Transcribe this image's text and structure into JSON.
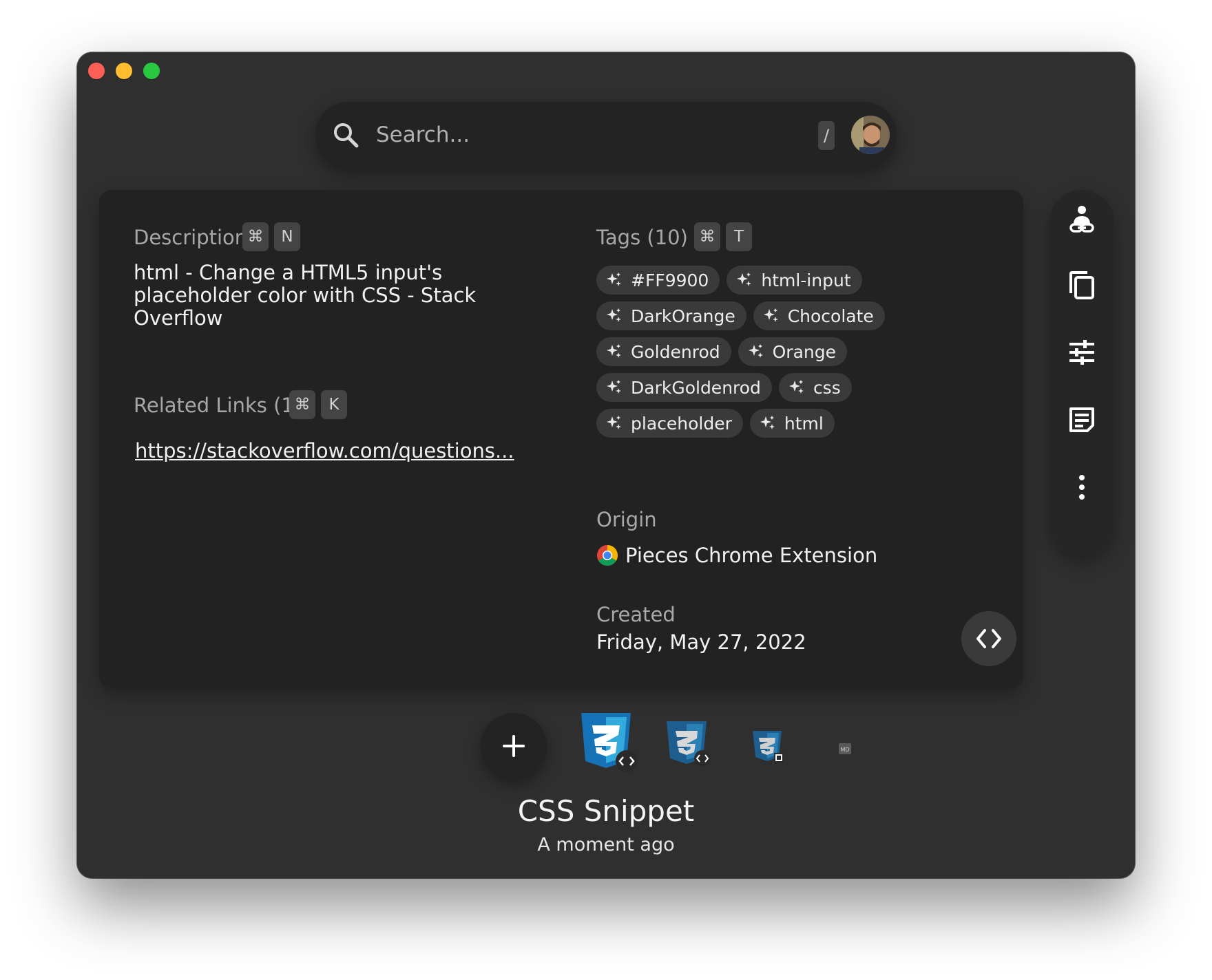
{
  "search": {
    "placeholder": "Search...",
    "shortcut": "/"
  },
  "description": {
    "label": "Description",
    "kbd": [
      "⌘",
      "N"
    ],
    "text": "html - Change a HTML5 input's placeholder color with CSS - Stack Overflow"
  },
  "related_links": {
    "label": "Related Links (1)",
    "kbd": [
      "⌘",
      "K"
    ],
    "links": [
      "https://stackoverflow.com/questions..."
    ]
  },
  "tags": {
    "label": "Tags (10)",
    "kbd": [
      "⌘",
      "T"
    ],
    "items": [
      "#FF9900",
      "html-input",
      "DarkOrange",
      "Chocolate",
      "Goldenrod",
      "Orange",
      "DarkGoldenrod",
      "css",
      "placeholder",
      "html"
    ]
  },
  "origin": {
    "label": "Origin",
    "value": "Pieces Chrome Extension",
    "icon": "chrome-icon"
  },
  "created": {
    "label": "Created",
    "value": "Friday, May 27, 2022"
  },
  "rail": {
    "icons": [
      "share-link-icon",
      "copy-icon",
      "tune-icon",
      "notes-icon",
      "more-vert-icon"
    ]
  },
  "snippet": {
    "title": "CSS Snippet",
    "subtitle": "A moment ago",
    "format_badge": "MD",
    "brand_color": "#1572b6"
  }
}
